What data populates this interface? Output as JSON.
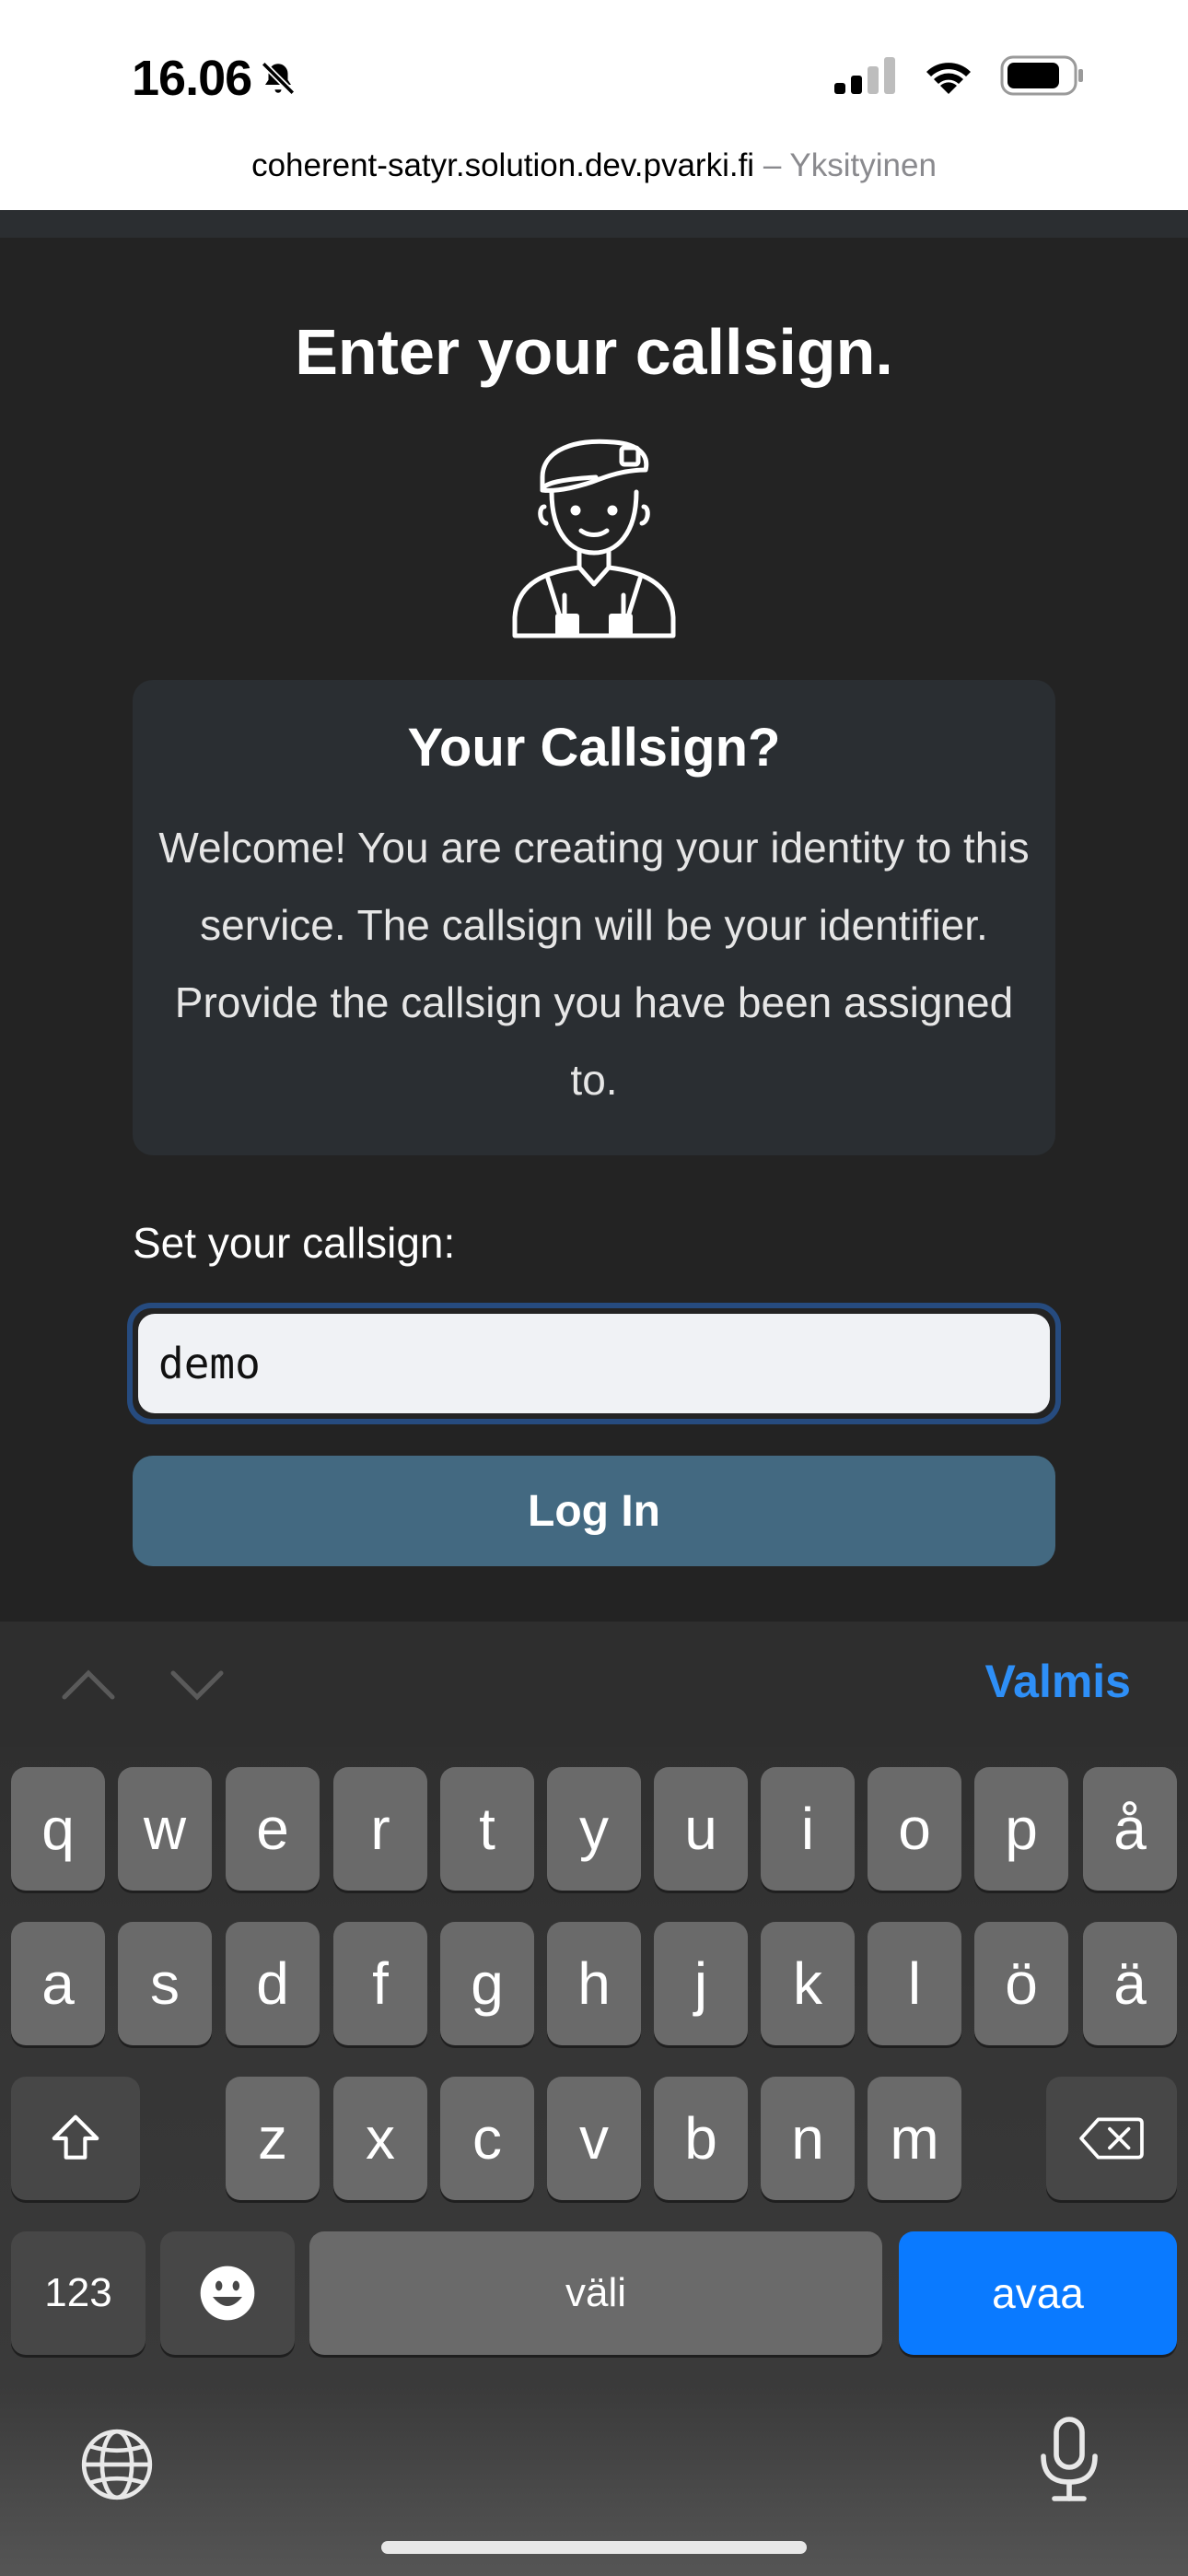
{
  "status_bar": {
    "time": "16.06",
    "icons": [
      "bell-slash-icon",
      "cellular-signal-icon",
      "wifi-icon",
      "battery-icon"
    ]
  },
  "browser": {
    "url": "coherent-satyr.solution.dev.pvarki.fi",
    "separator": "–",
    "mode": "Yksityinen"
  },
  "page": {
    "title": "Enter your callsign.",
    "card_title": "Your Callsign?",
    "card_text": "Welcome! You are creating your identity to this service. The callsign will be your identifier. Provide the callsign you have been assigned to.",
    "field_label": "Set your callsign:",
    "input_value": "demo",
    "login_label": "Log In"
  },
  "keyboard": {
    "done_label": "Valmis",
    "row1": [
      "q",
      "w",
      "e",
      "r",
      "t",
      "y",
      "u",
      "i",
      "o",
      "p",
      "å"
    ],
    "row2": [
      "a",
      "s",
      "d",
      "f",
      "g",
      "h",
      "j",
      "k",
      "l",
      "ö",
      "ä"
    ],
    "row3": [
      "z",
      "x",
      "c",
      "v",
      "b",
      "n",
      "m"
    ],
    "numbers_label": "123",
    "space_label": "väli",
    "return_label": "avaa"
  },
  "colors": {
    "accent_blue": "#0a7aff",
    "login_button": "#436981",
    "page_background": "#232323",
    "card_background": "#2a2e32"
  }
}
